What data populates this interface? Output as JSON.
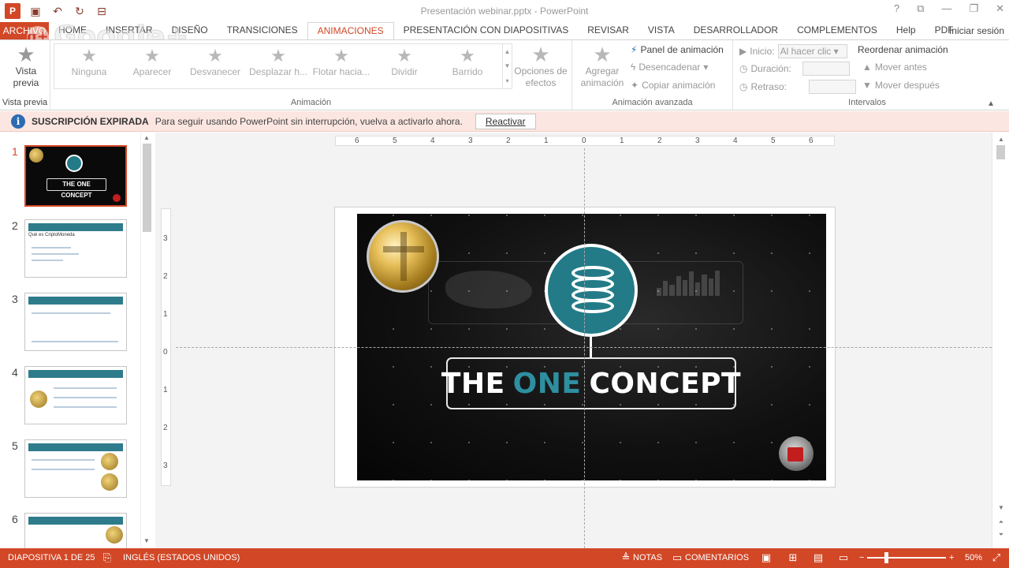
{
  "window": {
    "doc_title": "Presentación webinar.pptx - PowerPoint",
    "app_logo": "P",
    "controls": [
      "?",
      "⧉",
      "—",
      "❐",
      "✕"
    ]
  },
  "tabs": {
    "file": "ARCHIVO",
    "items": [
      "HOME",
      "INSERTAR",
      "DISEÑO",
      "TRANSICIONES",
      "ANIMACIONES",
      "PRESENTACIÓN CON DIAPOSITIVAS",
      "REVISAR",
      "VISTA",
      "DESARROLLADOR",
      "COMPLEMENTOS",
      "Help",
      "PDF"
    ],
    "active": "ANIMACIONES",
    "signin": "Iniciar sesión"
  },
  "ribbon": {
    "preview": {
      "label_1": "Vista",
      "label_2": "previa",
      "group": "Vista previa"
    },
    "animations": [
      "Ninguna",
      "Aparecer",
      "Desvanecer",
      "Desplazar h...",
      "Flotar hacia...",
      "Dividir",
      "Barrido"
    ],
    "effect_options": {
      "line_1": "Opciones de",
      "line_2": "efectos"
    },
    "group_animation": "Animación",
    "add_animation": {
      "line_1": "Agregar",
      "line_2": "animación"
    },
    "anim_panel": "Panel de animación",
    "trigger": "Desencadenar",
    "copy_anim": "Copiar animación",
    "group_advanced": "Animación avanzada",
    "start_label": "Inicio:",
    "start_value": "Al hacer clic",
    "duration_label": "Duración:",
    "delay_label": "Retraso:",
    "reorder_title": "Reordenar animación",
    "move_earlier": "Mover antes",
    "move_later": "Mover después",
    "group_timing": "Intervalos"
  },
  "notification": {
    "title": "SUSCRIPCIÓN EXPIRADA",
    "text": "Para seguir usando PowerPoint sin interrupción, vuelva a activarlo ahora.",
    "button": "Reactivar"
  },
  "thumbnails": {
    "numbers": [
      "1",
      "2",
      "3",
      "4",
      "5",
      "6"
    ],
    "t2_caption": "Qué es CriptoMoneda"
  },
  "slide": {
    "title_word_1": "THE",
    "title_word_2": "ONE",
    "title_word_3": "CONCEPT"
  },
  "thumb1_title": "THE ONE CONCEPT",
  "rulers": {
    "h": [
      "6",
      "5",
      "4",
      "3",
      "2",
      "1",
      "0",
      "1",
      "2",
      "3",
      "4",
      "5",
      "6"
    ],
    "v": [
      "3",
      "2",
      "1",
      "0",
      "1",
      "2",
      "3"
    ]
  },
  "status": {
    "slide_info": "DIAPOSITIVA 1 DE 25",
    "language": "INGLÉS (ESTADOS UNIDOS)",
    "notes": "NOTAS",
    "comments": "COMENTARIOS",
    "zoom": "50%",
    "zoom_minus": "−",
    "zoom_plus": "+"
  },
  "watermark": "Google+"
}
